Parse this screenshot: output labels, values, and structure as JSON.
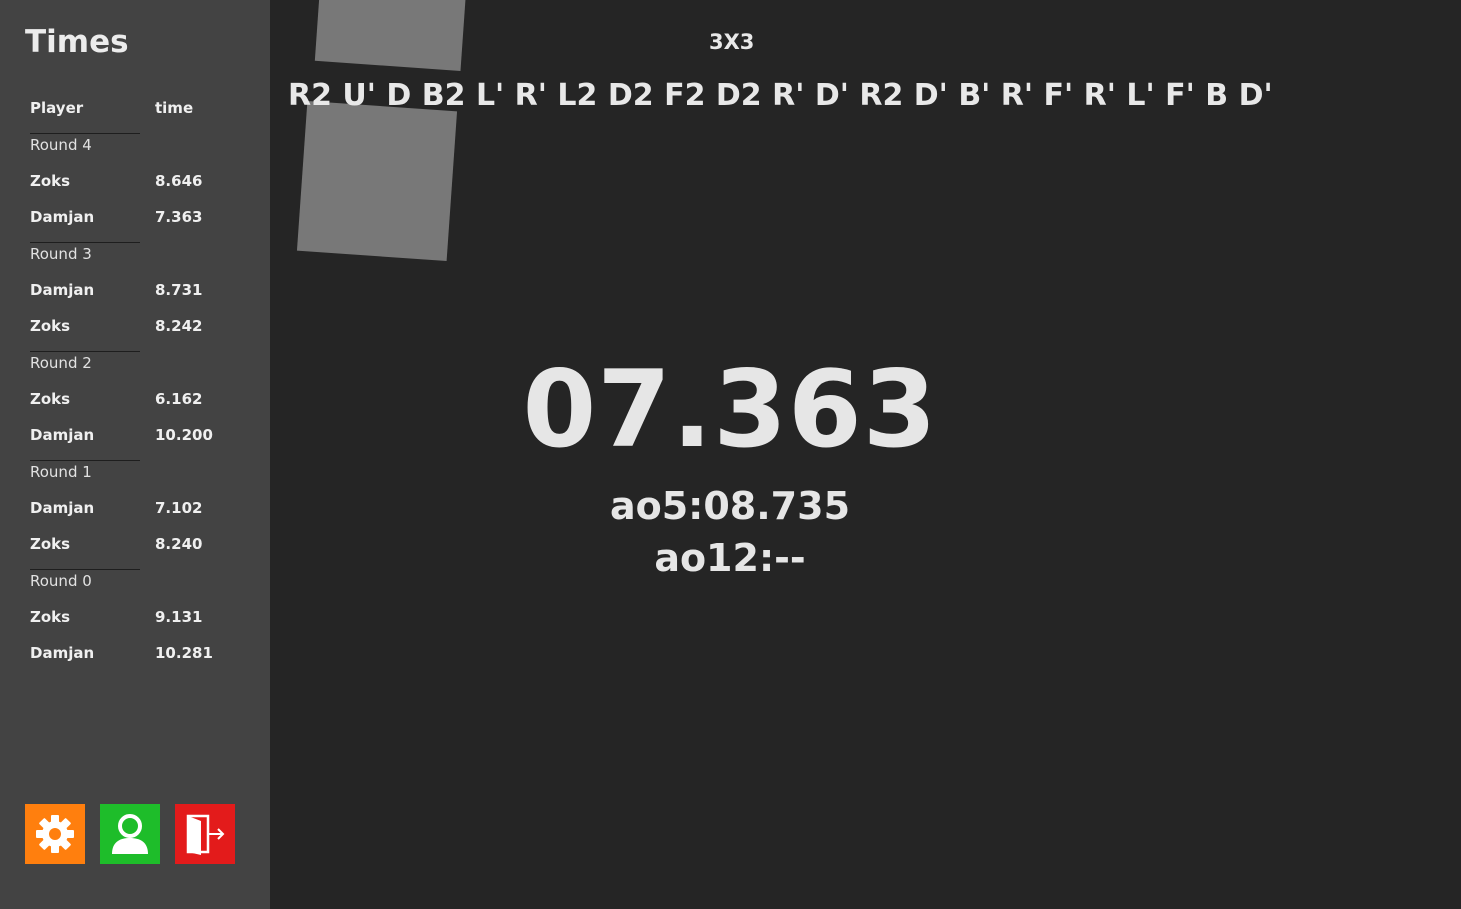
{
  "sidebar": {
    "title": "Times",
    "headers": {
      "player": "Player",
      "time": "time"
    },
    "rounds": [
      {
        "label": "Round 4",
        "entries": [
          {
            "player": "Zoks",
            "time": "8.646"
          },
          {
            "player": "Damjan",
            "time": "7.363"
          }
        ]
      },
      {
        "label": "Round 3",
        "entries": [
          {
            "player": "Damjan",
            "time": "8.731"
          },
          {
            "player": "Zoks",
            "time": "8.242"
          }
        ]
      },
      {
        "label": "Round 2",
        "entries": [
          {
            "player": "Zoks",
            "time": "6.162"
          },
          {
            "player": "Damjan",
            "time": "10.200"
          }
        ]
      },
      {
        "label": "Round 1",
        "entries": [
          {
            "player": "Damjan",
            "time": "7.102"
          },
          {
            "player": "Zoks",
            "time": "8.240"
          }
        ]
      },
      {
        "label": "Round 0",
        "entries": [
          {
            "player": "Zoks",
            "time": "9.131"
          },
          {
            "player": "Damjan",
            "time": "10.281"
          }
        ]
      }
    ],
    "buttons": {
      "settings": {
        "icon": "gear-icon",
        "color": "#ff7f0e"
      },
      "profile": {
        "icon": "user-icon",
        "color": "#1ebd2a"
      },
      "logout": {
        "icon": "exit-door-icon",
        "color": "#e31b1b"
      }
    }
  },
  "main": {
    "puzzle": "3X3",
    "scramble": "R2 U' D B2 L' R' L2 D2 F2 D2 R' D' R2 D' B' R' F' R' L' F' B D'",
    "timer": "07.363",
    "ao5": "ao5:08.735",
    "ao12": "ao12:--"
  },
  "colors": {
    "background": "#252525",
    "sidebar": "#434343",
    "text": "#e6e6e6"
  }
}
